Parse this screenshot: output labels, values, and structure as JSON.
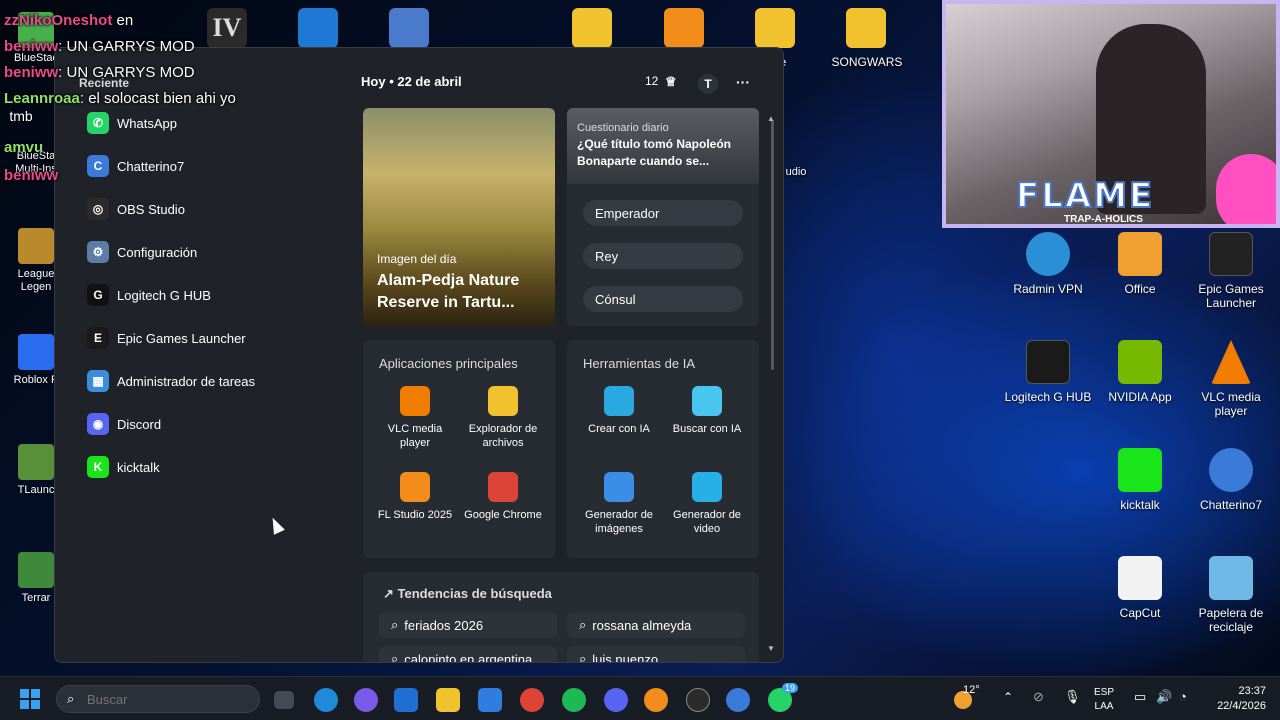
{
  "chat": [
    {
      "user": "zzNikoOneshot",
      "text": "en"
    },
    {
      "user": "beniww",
      "text": ": UN GARRYS MOD"
    },
    {
      "user": "beniww",
      "text": ": UN GARRYS MOD"
    },
    {
      "user": "Leannroaa",
      "text": ": el solocast bien ahi yo"
    },
    {
      "user": "amvu",
      "text": ""
    },
    {
      "user": "beniww",
      "text": ""
    }
  ],
  "desktop_left": [
    "BlueStac",
    "tmb",
    "BlueSta Multi-Ins",
    "League Legen",
    "Roblox P",
    "TLaunc",
    "Terrar"
  ],
  "desktop_top_right": [
    "me",
    "SONGWARS",
    "udio"
  ],
  "desktop_icons": [
    {
      "label": "Radmin VPN",
      "color": "#2b8fd8",
      "icon": "radmin-vpn-icon"
    },
    {
      "label": "Office",
      "color": "#f0a030",
      "icon": "office-folder-icon"
    },
    {
      "label": "Epic Games Launcher",
      "color": "#222222",
      "icon": "epic-games-icon"
    },
    {
      "label": "Logitech G HUB",
      "color": "#1a1a1a",
      "icon": "logitech-icon"
    },
    {
      "label": "NVIDIA App",
      "color": "#76b900",
      "icon": "nvidia-icon"
    },
    {
      "label": "VLC media player",
      "color": "#f07c00",
      "icon": "vlc-icon"
    },
    {
      "label": "kicktalk",
      "color": "#19e51a",
      "icon": "kicktalk-icon"
    },
    {
      "label": "Chatterino7",
      "color": "#3a7ad8",
      "icon": "chatterino-icon"
    },
    {
      "label": "CapCut",
      "color": "#f2f2f2",
      "icon": "capcut-icon"
    },
    {
      "label": "Papelera de reciclaje",
      "color": "#6fb9e6",
      "icon": "recycle-bin-icon"
    }
  ],
  "start_menu": {
    "recent_title": "Reciente",
    "apps": [
      {
        "label": "WhatsApp",
        "icon": "whatsapp-icon",
        "color": "#25d366",
        "glyph": "✆"
      },
      {
        "label": "Chatterino7",
        "icon": "chatterino-icon",
        "color": "#3a7ad8",
        "glyph": "C"
      },
      {
        "label": "OBS Studio",
        "icon": "obs-icon",
        "color": "#2b2b2b",
        "glyph": "◎"
      },
      {
        "label": "Configuración",
        "icon": "settings-gear-icon",
        "color": "#5b7da8",
        "glyph": "⚙"
      },
      {
        "label": "Logitech G HUB",
        "icon": "logitech-icon",
        "color": "#111111",
        "glyph": "G"
      },
      {
        "label": "Epic Games Launcher",
        "icon": "epic-games-icon",
        "color": "#1a1a1a",
        "glyph": "E"
      },
      {
        "label": "Administrador de tareas",
        "icon": "task-manager-icon",
        "color": "#3b8de0",
        "glyph": "▦"
      },
      {
        "label": "Discord",
        "icon": "discord-icon",
        "color": "#5865f2",
        "glyph": "◉"
      },
      {
        "label": "kicktalk",
        "icon": "kicktalk-icon",
        "color": "#19e51a",
        "glyph": "K"
      }
    ]
  },
  "widgets": {
    "today": "Hoy",
    "date": "22 de abril",
    "count": "12",
    "avatar": "T",
    "image_of_day": {
      "kicker": "Imagen del día",
      "title": "Alam-Pedja Nature Reserve in Tartu..."
    },
    "quiz": {
      "kicker": "Cuestionario diario",
      "question": "¿Qué título tomó Napoleón Bonaparte cuando se...",
      "options": [
        "Emperador",
        "Rey",
        "Cónsul"
      ]
    },
    "top_apps": {
      "title": "Aplicaciones principales",
      "items": [
        {
          "label": "VLC media player",
          "color": "#f07c00",
          "icon": "vlc-icon"
        },
        {
          "label": "Explorador de archivos",
          "color": "#f2c12e",
          "icon": "file-explorer-icon"
        },
        {
          "label": "FL Studio 2025",
          "color": "#f28c1a",
          "icon": "fl-studio-icon"
        },
        {
          "label": "Google Chrome",
          "color": "#db4437",
          "icon": "chrome-icon"
        }
      ]
    },
    "ai_tools": {
      "title": "Herramientas de IA",
      "items": [
        {
          "label": "Crear con IA",
          "color": "#2aa9e0",
          "icon": "create-ai-icon"
        },
        {
          "label": "Buscar con IA",
          "color": "#48c6ef",
          "icon": "search-ai-icon"
        },
        {
          "label": "Generador de imágenes",
          "color": "#3a8ee8",
          "icon": "image-generator-icon"
        },
        {
          "label": "Generador de video",
          "color": "#27b0e8",
          "icon": "video-generator-icon"
        }
      ]
    },
    "trends": {
      "title": "Tendencias de búsqueda",
      "items": [
        "feriados 2026",
        "rossana almeyda",
        "calopinto en argentina",
        "luis nuenzo"
      ]
    }
  },
  "webcam": {
    "banner": "FLAME",
    "sub": "TRAP-A-HOLICS"
  },
  "taskbar": {
    "search_placeholder": "Buscar",
    "weather": "12°",
    "lang1": "ESP",
    "lang2": "LAA",
    "time": "23:37",
    "date": "22/4/2026",
    "badge": "19"
  }
}
